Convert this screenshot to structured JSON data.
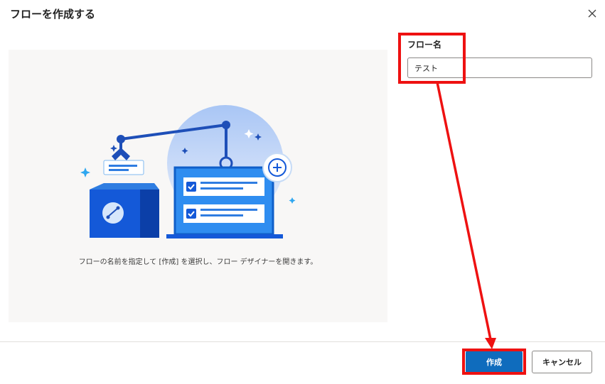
{
  "dialog": {
    "title": "フローを作成する",
    "close_icon": "close-icon"
  },
  "illustration": {
    "caption": "フローの名前を指定して [作成] を選択し、フロー デザイナーを開きます。"
  },
  "form": {
    "flow_name_label": "フロー名",
    "flow_name_value": "テスト"
  },
  "footer": {
    "create_label": "作成",
    "cancel_label": "キャンセル"
  },
  "colors": {
    "primary": "#0f6cbd",
    "annotation": "#ee1111",
    "panel_background": "#f8f7f6"
  }
}
